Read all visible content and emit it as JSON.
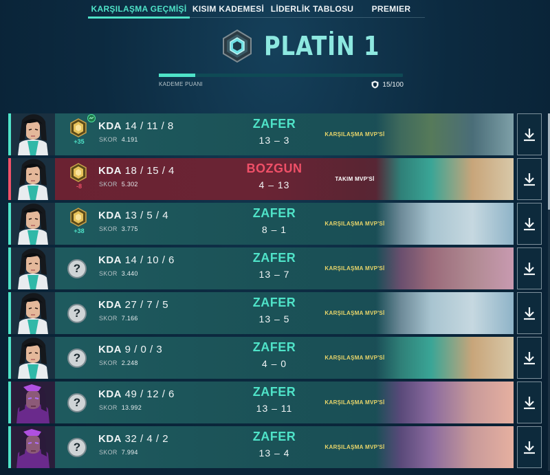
{
  "tabs": [
    {
      "label": "KARŞILAŞMA GEÇMİŞİ",
      "active": true
    },
    {
      "label": "KISIM KADEMESİ",
      "active": false
    },
    {
      "label": "LİDERLİK TABLOSU",
      "active": false
    },
    {
      "label": "PREMIER",
      "active": false
    }
  ],
  "rank": {
    "title": "PLATİN 1",
    "progress_label": "KADEME PUANI",
    "progress_value": "15/100",
    "progress_fraction": 0.15
  },
  "labels": {
    "kda": "KDA",
    "score": "SKOR"
  },
  "colors": {
    "accent": "#4fe3c8",
    "loss": "#f05068",
    "match_mvp": "#e8d56a"
  },
  "matches": [
    {
      "outcome": "win",
      "badge": "gold-rank-badge",
      "rr": "+35",
      "new": true,
      "kda": "14 / 11 / 8",
      "score": "4.191",
      "result": "ZAFER",
      "final": "13 – 3",
      "mvp": "KARŞILAŞMA MVP'Sİ",
      "mvp_type": "match",
      "agent": "sage",
      "map": "forest"
    },
    {
      "outcome": "loss",
      "badge": "gold-rank-badge",
      "rr": "-8",
      "new": false,
      "kda": "18 / 15 / 4",
      "score": "5.302",
      "result": "BOZGUN",
      "final": "4 – 13",
      "mvp": "TAKIM MVP'Sİ",
      "mvp_type": "team",
      "agent": "sage",
      "map": "teal-city"
    },
    {
      "outcome": "win",
      "badge": "gold-rank-badge",
      "rr": "+38",
      "new": false,
      "kda": "13 / 5 / 4",
      "score": "3.775",
      "result": "ZAFER",
      "final": "8 – 1",
      "mvp": "KARŞILAŞMA MVP'Sİ",
      "mvp_type": "match",
      "agent": "sage",
      "map": "icebox"
    },
    {
      "outcome": "win",
      "badge": "unknown-badge",
      "rr": "",
      "new": false,
      "kda": "14 / 10 / 6",
      "score": "3.440",
      "result": "ZAFER",
      "final": "13 – 7",
      "mvp": "KARŞILAŞMA MVP'Sİ",
      "mvp_type": "match",
      "agent": "sage",
      "map": "purple-town"
    },
    {
      "outcome": "win",
      "badge": "unknown-badge",
      "rr": "",
      "new": false,
      "kda": "27 / 7 / 5",
      "score": "7.166",
      "result": "ZAFER",
      "final": "13 – 5",
      "mvp": "KARŞILAŞMA MVP'Sİ",
      "mvp_type": "match",
      "agent": "sage",
      "map": "icebox"
    },
    {
      "outcome": "win",
      "badge": "unknown-badge",
      "rr": "",
      "new": false,
      "kda": "9 / 0 / 3",
      "score": "2.248",
      "result": "ZAFER",
      "final": "4 – 0",
      "mvp": "KARŞILAŞMA MVP'Sİ",
      "mvp_type": "match",
      "agent": "sage",
      "map": "teal-city"
    },
    {
      "outcome": "win",
      "badge": "unknown-badge",
      "rr": "",
      "new": false,
      "kda": "49 / 12 / 6",
      "score": "13.992",
      "result": "ZAFER",
      "final": "13 – 11",
      "mvp": "KARŞILAŞMA MVP'Sİ",
      "mvp_type": "match",
      "agent": "reyna",
      "map": "sunset-city"
    },
    {
      "outcome": "win",
      "badge": "unknown-badge",
      "rr": "",
      "new": false,
      "kda": "32 / 4 / 2",
      "score": "7.994",
      "result": "ZAFER",
      "final": "13 – 4",
      "mvp": "KARŞILAŞMA MVP'Sİ",
      "mvp_type": "match",
      "agent": "reyna",
      "map": "sunset-city"
    }
  ]
}
